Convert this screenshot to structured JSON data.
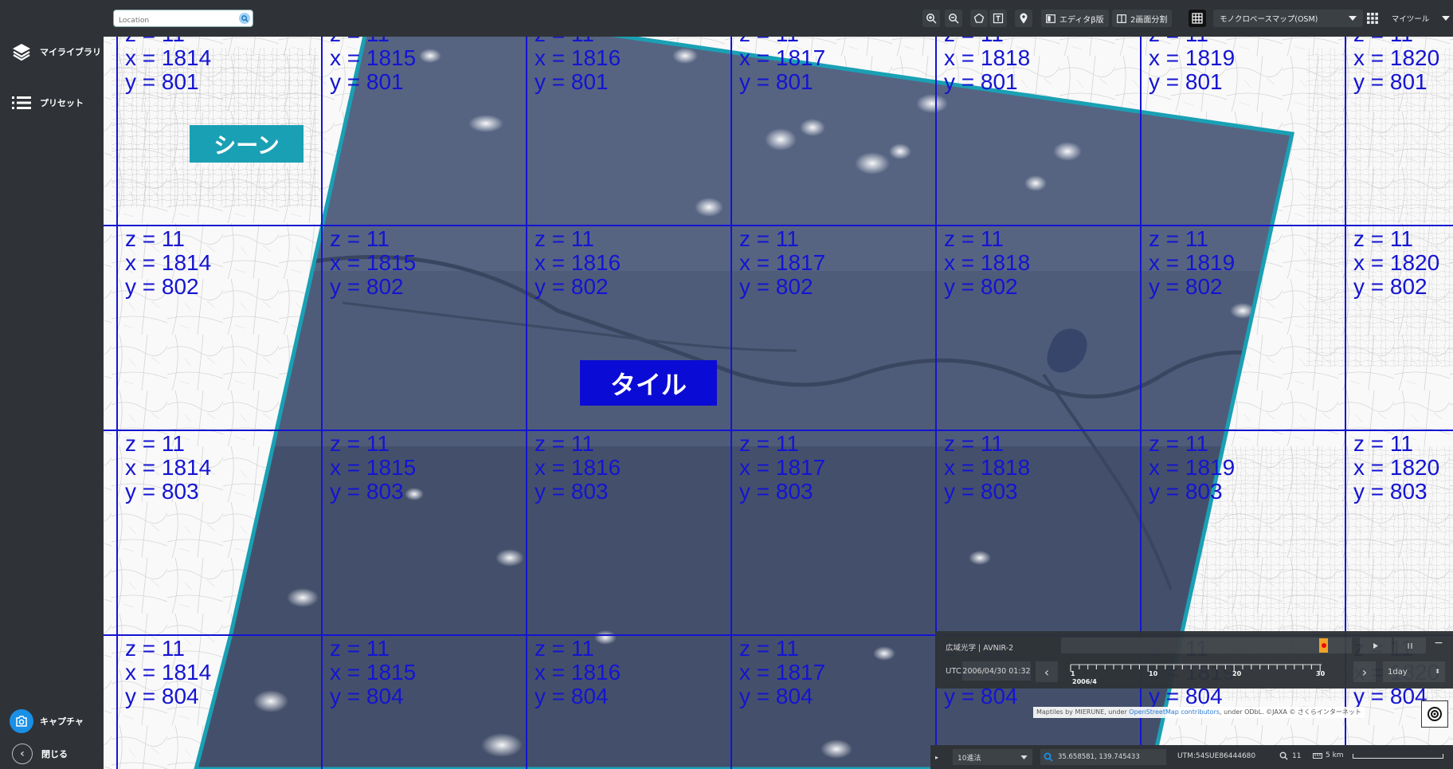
{
  "sidebar": {
    "library": "マイライブラリ",
    "preset": "プリセット",
    "capture": "キャプチャ",
    "close": "閉じる"
  },
  "search": {
    "placeholder": "Location"
  },
  "toolbar": {
    "editor": "エディタβ版",
    "split": "2画面分割",
    "basemap": "モノクロベースマップ(OSM)",
    "mytools": "マイツール"
  },
  "labels": {
    "scene": "シーン",
    "tile": "タイル"
  },
  "tiles": {
    "z": 11,
    "xs": [
      1814,
      1815,
      1816,
      1817,
      1818,
      1819,
      1820
    ],
    "ys": [
      801,
      802,
      803,
      804
    ],
    "z_prefix": "z = ",
    "x_prefix": "x = ",
    "y_prefix": "y = "
  },
  "timeline": {
    "sensor": "広域光学 | AVNIR-2",
    "utc_label": "UTC",
    "datetime": "2006/04/30 01:32",
    "ticks": [
      "1",
      "10",
      "20",
      "30"
    ],
    "month": "2006/4",
    "step": "1day"
  },
  "attribution": {
    "prefix": "Maptiles by MIERUNE, under ",
    "link": "OpenStreetMap contributors",
    "suffix": ", under ODbL. ©JAXA © さくらインターネット"
  },
  "status": {
    "coord_system": "10進法",
    "coords": "35.658581, 139.745433",
    "utm": "UTM:54SUE86444680",
    "zoom": "11",
    "scale": "5 km"
  },
  "colors": {
    "sidebar_bg": "#2f3337",
    "tile_grid": "#1414d2",
    "scene_outline": "#1aa0b4",
    "tile_label_bg": "#0b0bd6",
    "scene_label_bg": "#1aa0b4"
  }
}
